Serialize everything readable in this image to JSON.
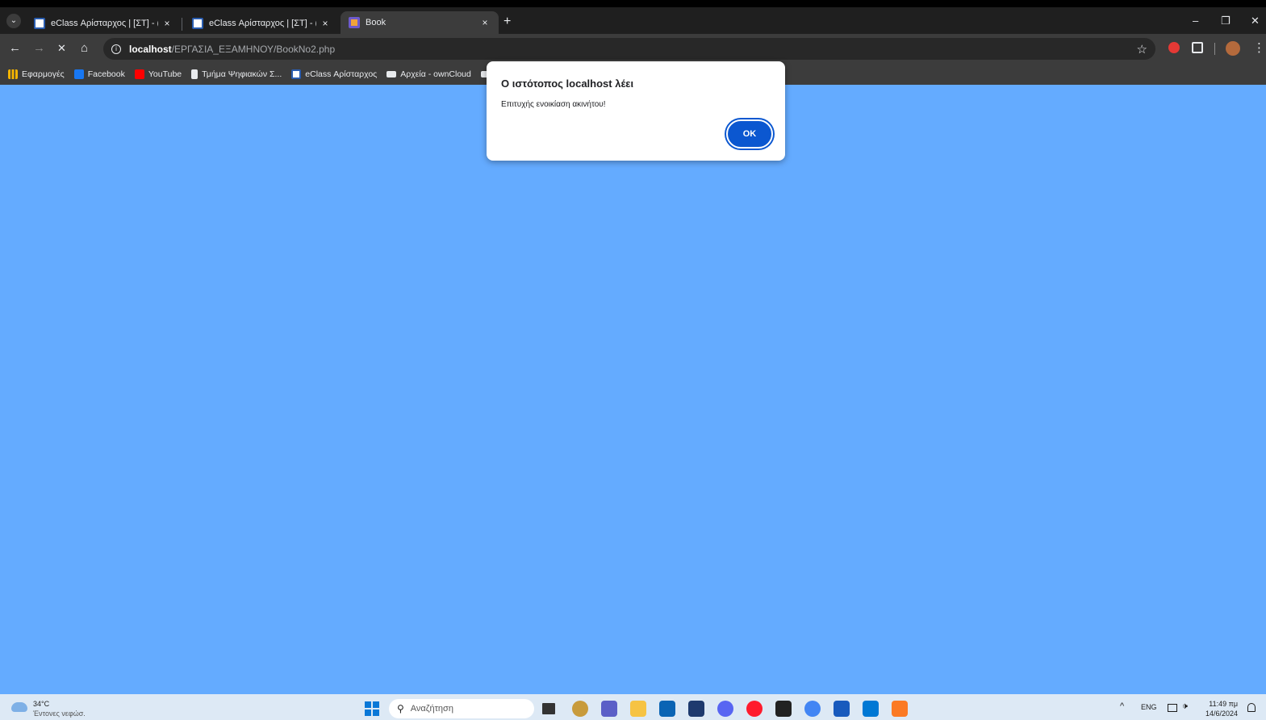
{
  "browser": {
    "tabs": [
      {
        "title": "eClass Αρίσταρχος | [ΣΤ] - (ΨΣ-",
        "close": "×",
        "icon": "eclass-icon"
      },
      {
        "title": "eClass Αρίσταρχος | [ΣΤ] - (ΨΣ-",
        "close": "×",
        "icon": "eclass-icon"
      },
      {
        "title": "Book",
        "close": "×",
        "icon": "book-favicon-icon"
      }
    ],
    "new_tab": "+",
    "window_controls": {
      "minimize": "–",
      "restore": "❐",
      "close": "✕"
    },
    "nav": {
      "back": "←",
      "forward": "→",
      "stop": "✕",
      "home": "⌂"
    },
    "url": {
      "host": "localhost",
      "path": "/ΕΡΓΑΣΙΑ_ΕΞΑΜΗΝΟΥ/BookNo2.php"
    },
    "bookmark_star": "☆",
    "menu": "⋮"
  },
  "bookmarks": [
    {
      "label": "Εφαρμογές",
      "icon": "apps-grid-icon"
    },
    {
      "label": "Facebook",
      "icon": "facebook-icon"
    },
    {
      "label": "YouTube",
      "icon": "youtube-icon"
    },
    {
      "label": "Τμήμα Ψηφιακών Σ...",
      "icon": "department-icon"
    },
    {
      "label": "eClass Αρίσταρχος",
      "icon": "eclass-icon"
    },
    {
      "label": "Αρχεία - ownCloud",
      "icon": "cloud-icon"
    }
  ],
  "dialog": {
    "title": "Ο ιστότοπος localhost λέει",
    "message": "Επιτυχής ενοικίαση ακινήτου!",
    "ok_label": "OK"
  },
  "page": {
    "background_color": "#64abff"
  },
  "taskbar": {
    "weather": {
      "temp": "34°C",
      "desc": "Έντονες νεφώσ."
    },
    "search_placeholder": "Αναζήτηση",
    "search_icon": "⚲",
    "tray": {
      "chevron": "^",
      "lang": "ENG",
      "volume": "🕩"
    },
    "clock": {
      "time": "11:49 πμ",
      "date": "14/6/2024"
    }
  }
}
